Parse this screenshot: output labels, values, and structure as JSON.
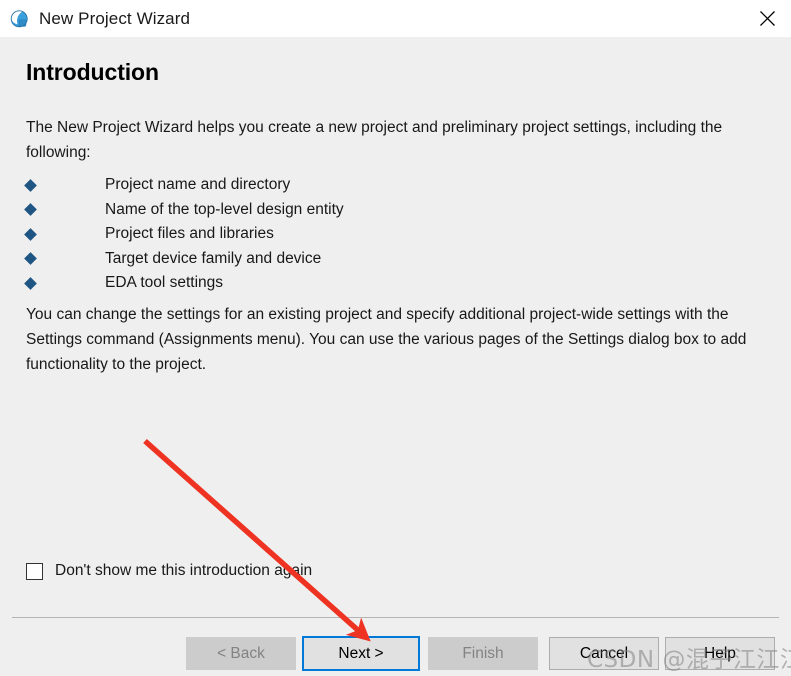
{
  "window": {
    "title": "New Project Wizard",
    "icon": "globe-icon",
    "close_label": "×",
    "titlebar_bg": "#ffffff",
    "body_bg": "#efefef"
  },
  "page": {
    "heading": "Introduction",
    "intro_paragraph": "The New Project Wizard helps you create a new project and preliminary project settings, including the following:",
    "bullets": [
      {
        "label": "Project name and directory"
      },
      {
        "label": "Name of the top-level design entity"
      },
      {
        "label": "Project files and libraries"
      },
      {
        "label": "Target device family and device"
      },
      {
        "label": "EDA tool settings"
      }
    ],
    "bullet_color": "#1f5582",
    "settings_paragraph": "You can change the settings for an existing project and specify additional project-wide settings with the Settings command (Assignments menu). You can use the various pages of the Settings dialog box to add functionality to the project."
  },
  "options": {
    "dont_show_label": "Don't show me this introduction again",
    "dont_show_checked": false
  },
  "buttons": {
    "back": {
      "label": "< Back",
      "enabled": false
    },
    "next": {
      "label": "Next >",
      "enabled": true,
      "default": true,
      "focus_color": "#0078d7"
    },
    "finish": {
      "label": "Finish",
      "enabled": false
    },
    "cancel": {
      "label": "Cancel",
      "enabled": true
    },
    "help": {
      "label": "Help",
      "enabled": true
    }
  },
  "annotation": {
    "arrow_color": "#ee3322",
    "arrow_from": "145,441",
    "arrow_to": "365,637"
  },
  "watermark": {
    "text": "CSDN @混子江江江"
  }
}
